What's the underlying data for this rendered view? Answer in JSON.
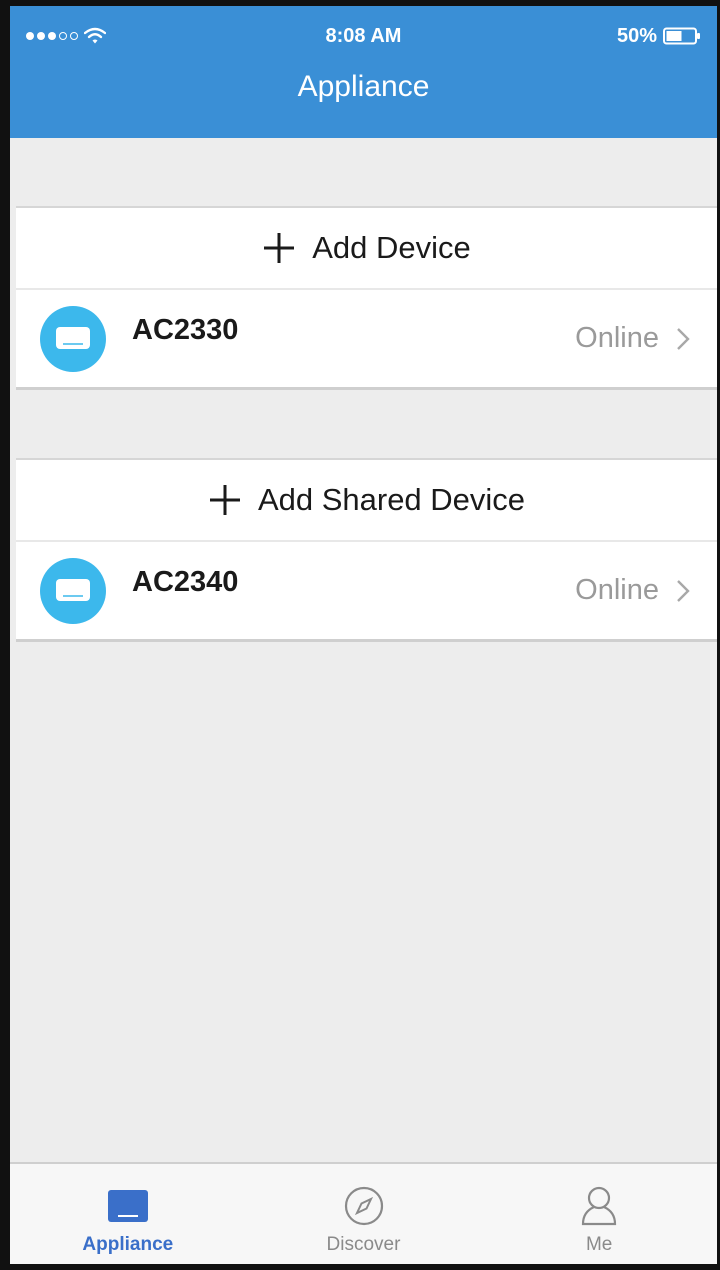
{
  "status_bar": {
    "time": "8:08 AM",
    "battery": "50%"
  },
  "header": {
    "title": "Appliance"
  },
  "sections": [
    {
      "add_label": "Add Device",
      "device": {
        "name": "AC2330",
        "status": "Online"
      }
    },
    {
      "add_label": "Add Shared Device",
      "device": {
        "name": "AC2340",
        "status": "Online"
      }
    }
  ],
  "tab_bar": {
    "tabs": [
      {
        "label": "Appliance",
        "icon": "appliance-icon",
        "active": true
      },
      {
        "label": "Discover",
        "icon": "compass-icon",
        "active": false
      },
      {
        "label": "Me",
        "icon": "person-icon",
        "active": false
      }
    ]
  },
  "colors": {
    "header_blue": "#3a8fd6",
    "device_icon_blue": "#3cb8ec",
    "active_tab": "#3a6fc9",
    "status_gray": "#9a9a9a"
  }
}
